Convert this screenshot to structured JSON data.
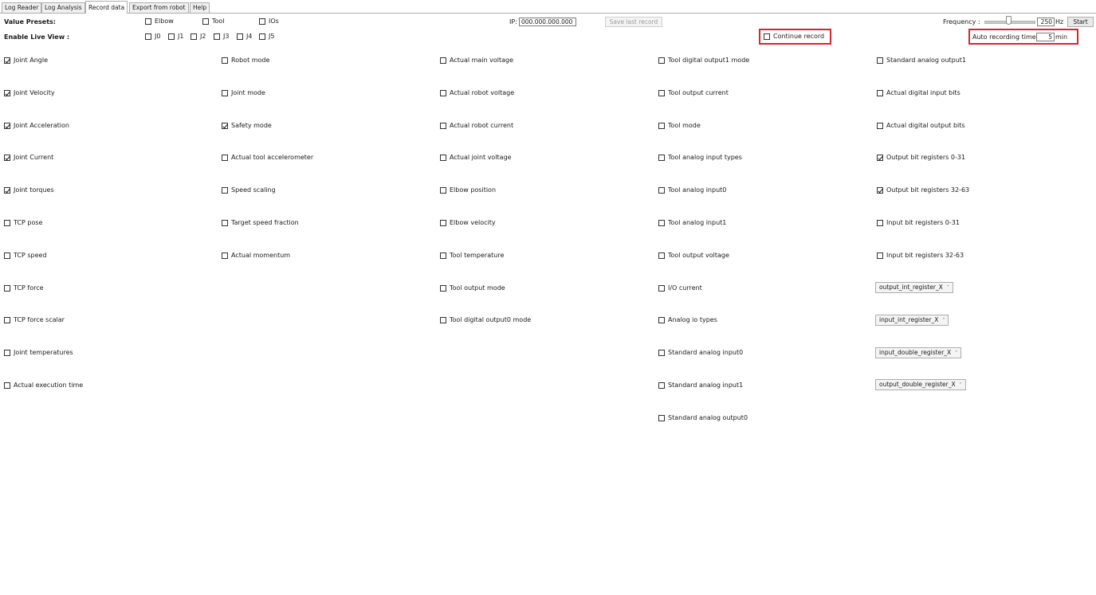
{
  "tabs": [
    {
      "label": "Log Reader"
    },
    {
      "label": "Log Analysis"
    },
    {
      "label": "Record data"
    },
    {
      "label": "Export from robot"
    },
    {
      "label": "Help"
    }
  ],
  "header": {
    "value_presets_label": "Value Presets:",
    "presets": [
      {
        "label": "Elbow",
        "checked": false
      },
      {
        "label": "Tool",
        "checked": false
      },
      {
        "label": "IOs",
        "checked": false
      }
    ],
    "live_view_label": "Enable Live View :",
    "joints": [
      {
        "label": "J0"
      },
      {
        "label": "J1"
      },
      {
        "label": "J2"
      },
      {
        "label": "J3"
      },
      {
        "label": "J4"
      },
      {
        "label": "J5"
      }
    ],
    "ip_label": "IP:",
    "ip_value": "000.000.000.000",
    "save_last_record": "Save last record",
    "continue_record": "Continue record",
    "frequency_label": "Frequency :",
    "frequency_value": "250",
    "frequency_unit": "Hz",
    "start": "Start",
    "auto_recording_label": "Auto recording time:",
    "auto_recording_value": "5",
    "auto_recording_unit": "min"
  },
  "columns": {
    "col1": [
      {
        "label": "Joint Angle",
        "checked": true
      },
      {
        "label": "Joint Velocity",
        "checked": true
      },
      {
        "label": "Joint Acceleration",
        "checked": true
      },
      {
        "label": "Joint Current",
        "checked": true
      },
      {
        "label": "Joint torques",
        "checked": true
      },
      {
        "label": "TCP pose",
        "checked": false
      },
      {
        "label": "TCP speed",
        "checked": false
      },
      {
        "label": "TCP force",
        "checked": false
      },
      {
        "label": "TCP force scalar",
        "checked": false
      },
      {
        "label": "Joint temperatures",
        "checked": false
      },
      {
        "label": "Actual execution time",
        "checked": false
      }
    ],
    "col2": [
      {
        "label": "Robot mode",
        "checked": false
      },
      {
        "label": "Joint mode",
        "checked": false
      },
      {
        "label": "Safety mode",
        "checked": true
      },
      {
        "label": "Actual tool accelerometer",
        "checked": false
      },
      {
        "label": "Speed scaling",
        "checked": false
      },
      {
        "label": "Target speed fraction",
        "checked": false
      },
      {
        "label": "Actual momentum",
        "checked": false
      }
    ],
    "col3": [
      {
        "label": "Actual main voltage",
        "checked": false
      },
      {
        "label": "Actual robot voltage",
        "checked": false
      },
      {
        "label": "Actual robot current",
        "checked": false
      },
      {
        "label": "Actual joint voltage",
        "checked": false
      },
      {
        "label": "Elbow position",
        "checked": false
      },
      {
        "label": "Elbow velocity",
        "checked": false
      },
      {
        "label": "Tool temperature",
        "checked": false
      },
      {
        "label": "Tool output mode",
        "checked": false
      },
      {
        "label": "Tool digital output0 mode",
        "checked": false
      }
    ],
    "col4": [
      {
        "label": "Tool digital output1 mode",
        "checked": false
      },
      {
        "label": "Tool output current",
        "checked": false
      },
      {
        "label": "Tool mode",
        "checked": false
      },
      {
        "label": "Tool analog input types",
        "checked": false
      },
      {
        "label": "Tool analog input0",
        "checked": false
      },
      {
        "label": "Tool analog input1",
        "checked": false
      },
      {
        "label": "Tool output voltage",
        "checked": false
      },
      {
        "label": "I/O current",
        "checked": false
      },
      {
        "label": "Analog io types",
        "checked": false
      },
      {
        "label": "Standard analog input0",
        "checked": false
      },
      {
        "label": "Standard analog input1",
        "checked": false
      },
      {
        "label": "Standard analog output0",
        "checked": false
      }
    ],
    "col5": [
      {
        "label": "Standard analog output1",
        "checked": false
      },
      {
        "label": "Actual digital input bits",
        "checked": false
      },
      {
        "label": "Actual digital output bits",
        "checked": false
      },
      {
        "label": "Output bit registers 0-31",
        "checked": true
      },
      {
        "label": "Output bit registers 32-63",
        "checked": true
      },
      {
        "label": "Input bit registers 0-31",
        "checked": false
      },
      {
        "label": "Input bit registers 32-63",
        "checked": false
      }
    ],
    "col5_dropdowns": [
      {
        "label": "output_int_register_X"
      },
      {
        "label": "input_int_register_X"
      },
      {
        "label": "input_double_register_X"
      },
      {
        "label": "output_double_register_X"
      }
    ]
  }
}
